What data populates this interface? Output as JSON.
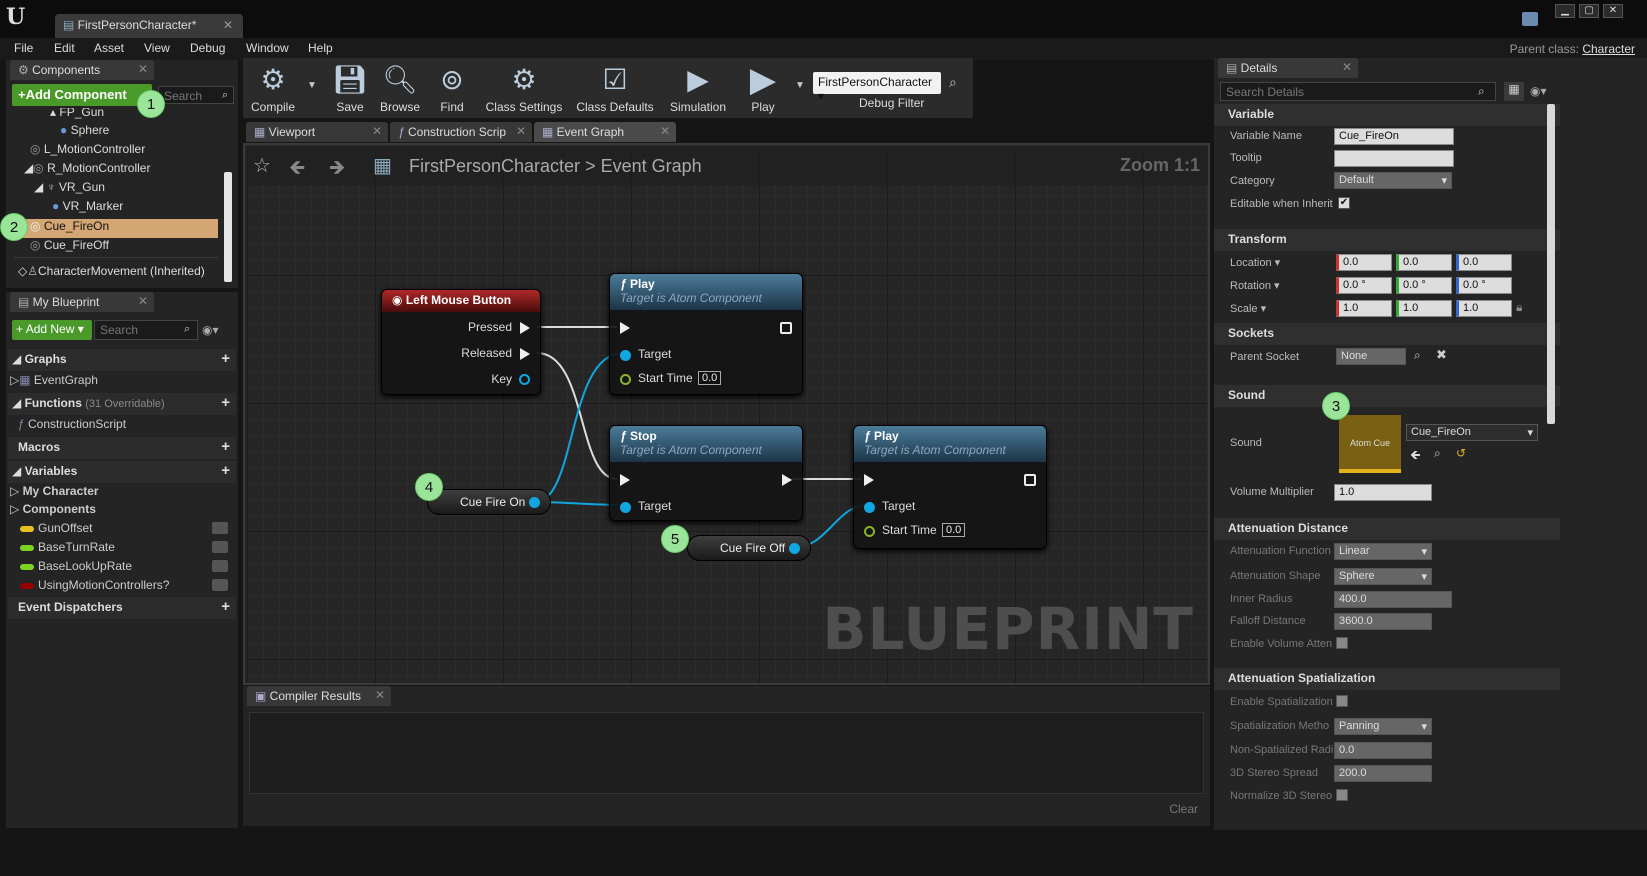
{
  "window": {
    "doc_tab": "FirstPersonCharacter*",
    "parent_class_label": "Parent class:",
    "parent_class_value": "Character"
  },
  "menu": [
    "File",
    "Edit",
    "Asset",
    "View",
    "Debug",
    "Window",
    "Help"
  ],
  "components": {
    "tab": "Components",
    "add_button": "+Add Component",
    "search_placeholder": "Search",
    "items": [
      "FP_Gun",
      "Sphere",
      "L_MotionController",
      "R_MotionController",
      "VR_Gun",
      "VR_Marker",
      "Cue_FireOn",
      "Cue_FireOff",
      "CharacterMovement (Inherited)"
    ]
  },
  "my_blueprint": {
    "tab": "My Blueprint",
    "add_button": "Add New",
    "search_placeholder": "Search",
    "graphs_label": "Graphs",
    "event_graph": "EventGraph",
    "functions_label": "Functions",
    "functions_count": "(31 Overridable)",
    "construction_script": "ConstructionScript",
    "macros_label": "Macros",
    "variables_label": "Variables",
    "my_character": "My Character",
    "components_label": "Components",
    "variables": [
      {
        "name": "GunOffset",
        "color": "#e8c020"
      },
      {
        "name": "BaseTurnRate",
        "color": "#7ed321"
      },
      {
        "name": "BaseLookUpRate",
        "color": "#7ed321"
      },
      {
        "name": "UsingMotionControllers?",
        "color": "#950000"
      }
    ],
    "dispatchers_label": "Event Dispatchers"
  },
  "toolbar": {
    "buttons": [
      "Compile",
      "Save",
      "Browse",
      "Find",
      "Class Settings",
      "Class Defaults",
      "Simulation",
      "Play"
    ],
    "debug_dropdown": "FirstPersonCharacter",
    "debug_filter": "Debug Filter"
  },
  "graph_tabs": [
    "Viewport",
    "Construction Scrip",
    "Event Graph"
  ],
  "breadcrumb": {
    "root": "FirstPersonCharacter",
    "sep": ">",
    "leaf": "Event Graph"
  },
  "zoom": "Zoom 1:1",
  "watermark": "BLUEPRINT",
  "nodes": {
    "lmb": {
      "title": "Left Mouse Button",
      "pins": [
        "Pressed",
        "Released",
        "Key"
      ]
    },
    "play1": {
      "title": "Play",
      "subtitle": "Target is Atom Component",
      "target": "Target",
      "start_time": "Start Time",
      "start_value": "0.0"
    },
    "stop": {
      "title": "Stop",
      "subtitle": "Target is Atom Component",
      "target": "Target"
    },
    "play2": {
      "title": "Play",
      "subtitle": "Target is Atom Component",
      "target": "Target",
      "start_time": "Start Time",
      "start_value": "0.0"
    },
    "cue_on": "Cue Fire On",
    "cue_off": "Cue Fire Off"
  },
  "callouts": [
    "1",
    "2",
    "3",
    "4",
    "5"
  ],
  "compiler": {
    "tab": "Compiler Results",
    "clear": "Clear"
  },
  "details": {
    "tab": "Details",
    "search_placeholder": "Search Details",
    "variable": {
      "section": "Variable",
      "name_label": "Variable Name",
      "name_value": "Cue_FireOn",
      "tooltip_label": "Tooltip",
      "tooltip_value": "",
      "category_label": "Category",
      "category_value": "Default",
      "editable_label": "Editable when Inherit"
    },
    "transform": {
      "section": "Transform",
      "location_label": "Location",
      "location": [
        "0.0",
        "0.0",
        "0.0"
      ],
      "rotation_label": "Rotation",
      "rotation": [
        "0.0 °",
        "0.0 °",
        "0.0 °"
      ],
      "scale_label": "Scale",
      "scale": [
        "1.0",
        "1.0",
        "1.0"
      ]
    },
    "sockets": {
      "section": "Sockets",
      "parent_label": "Parent Socket",
      "parent_value": "None"
    },
    "sound": {
      "section": "Sound",
      "sound_label": "Sound",
      "thumb_label": "Atom Cue",
      "sound_value": "Cue_FireOn",
      "volume_label": "Volume Multiplier",
      "volume_value": "1.0"
    },
    "attenuation": {
      "section": "Attenuation Distance",
      "function_label": "Attenuation Function",
      "function_value": "Linear",
      "shape_label": "Attenuation Shape",
      "shape_value": "Sphere",
      "inner_label": "Inner Radius",
      "inner_value": "400.0",
      "falloff_label": "Falloff Distance",
      "falloff_value": "3600.0",
      "volume_label": "Enable Volume Atten"
    },
    "spatial": {
      "section": "Attenuation Spatialization",
      "enable_label": "Enable Spatialization",
      "method_label": "Spatialization Metho",
      "method_value": "Panning",
      "nonspat_label": "Non-Spatialized Radi",
      "nonspat_value": "0.0",
      "stereo_label": "3D Stereo Spread",
      "stereo_value": "200.0",
      "normalize_label": "Normalize 3D Stereo"
    }
  }
}
